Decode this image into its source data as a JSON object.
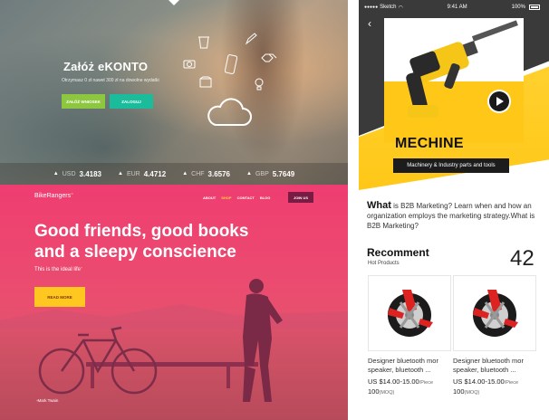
{
  "ekonto": {
    "title": "Załóż eKONTO",
    "subtitle": "Otrzymasz 0 zł nawet 300 zł na dowolne wydatki",
    "btn_primary": "ZAŁÓŻ WNIOSEK",
    "btn_secondary": "ZALOGUJ",
    "rates": [
      {
        "currency": "USD",
        "value": "3.4183"
      },
      {
        "currency": "EUR",
        "value": "4.4712"
      },
      {
        "currency": "CHF",
        "value": "3.6576"
      },
      {
        "currency": "GBP",
        "value": "5.7649"
      }
    ]
  },
  "bike": {
    "logo": "BikeRangers",
    "logo_dot": "°",
    "nav": {
      "about": "ABOUT",
      "shop": "SHOP",
      "contact": "CONTACT",
      "blog": "BLOG"
    },
    "join": "JOIN US",
    "headline": "Good friends, good books and a sleepy conscience",
    "tagline": "This is the ideal life",
    "tagline_mark": "\"",
    "cta": "READ MORE",
    "credit": "-Mark Twain"
  },
  "mobile": {
    "status": {
      "carrier": "Sketch",
      "time": "9:41 AM",
      "battery": "100%"
    },
    "hero_title": "MECHINE",
    "hero_category": "Machinery & Industry parts and tools",
    "desc_lead": "What",
    "desc_body": " is B2B Marketing? Learn when and how an organization employs the marketing strategy.What is B2B Marketing?",
    "rec_title": "Recomment",
    "rec_sub": "Hot Products",
    "rec_count": "42",
    "products": [
      {
        "name": "Designer bluetooth mor speaker, bluetooth ...",
        "price": "US $14.00-15.00",
        "price_unit": "/Piece",
        "moq": "100",
        "moq_unit": "(MOQ)"
      },
      {
        "name": "Designer bluetooth mor speaker, bluetooth ...",
        "price": "US $14.00-15.00",
        "price_unit": "/Piece",
        "moq": "100",
        "moq_unit": "(MOQ)"
      }
    ]
  },
  "colors": {
    "pink": "#ef3d71",
    "yellow": "#ffc818",
    "green": "#8dc63f",
    "teal": "#1abc9c"
  }
}
